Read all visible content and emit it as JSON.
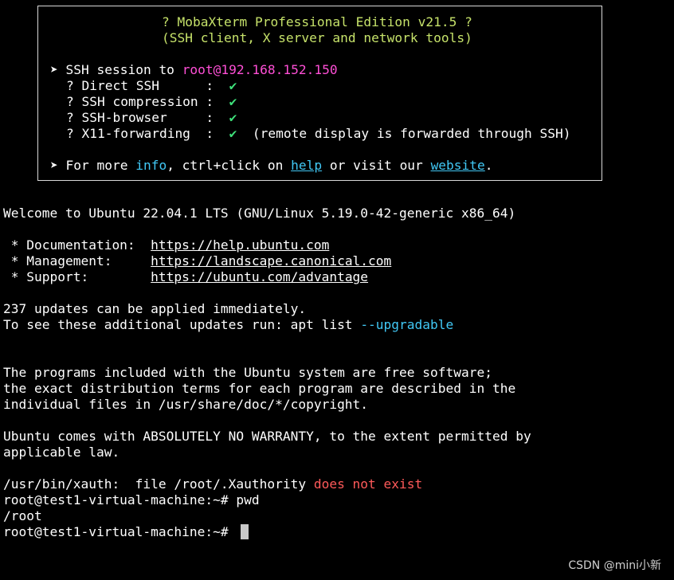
{
  "banner": {
    "title": "? MobaXterm Professional Edition v21.5 ?",
    "subtitle": "(SSH client, X server and network tools)",
    "session_prefix": "➤ SSH session to ",
    "session_host": "root@192.168.152.150",
    "opt_direct_ssh": "? Direct SSH      :  ",
    "opt_compression": "? SSH compression :  ",
    "opt_browser": "? SSH-browser     :  ",
    "opt_x11": "? X11-forwarding  :  ",
    "check": "✔",
    "x11_note": "  (remote display is forwarded through SSH)",
    "more_prefix": "➤ For more ",
    "more_info": "info",
    "more_mid": ", ctrl+click on ",
    "more_help": "help",
    "more_mid2": " or visit our ",
    "more_website": "website",
    "more_end": "."
  },
  "motd": {
    "welcome": "Welcome to Ubuntu 22.04.1 LTS (GNU/Linux 5.19.0-42-generic x86_64)",
    "doc_label": " * Documentation:  ",
    "doc_url": "https://help.ubuntu.com",
    "mgmt_label": " * Management:     ",
    "mgmt_url": "https://landscape.canonical.com",
    "support_label": " * Support:        ",
    "support_url": "https://ubuntu.com/advantage",
    "updates": "237 updates can be applied immediately.",
    "updates_hint_prefix": "To see these additional updates run: apt list ",
    "updates_hint_flag": "--upgradable",
    "free1": "The programs included with the Ubuntu system are free software;",
    "free2": "the exact distribution terms for each program are described in the",
    "free3": "individual files in /usr/share/doc/*/copyright.",
    "warranty1": "Ubuntu comes with ABSOLUTELY NO WARRANTY, to the extent permitted by",
    "warranty2": "applicable law.",
    "xauth_prefix": "/usr/bin/xauth:  file /root/.Xauthority ",
    "xauth_error": "does not exist"
  },
  "shell": {
    "prompt": "root@test1-virtual-machine:~# ",
    "cmd1": "pwd",
    "output1": "/root"
  },
  "watermark": "CSDN @mini小新"
}
